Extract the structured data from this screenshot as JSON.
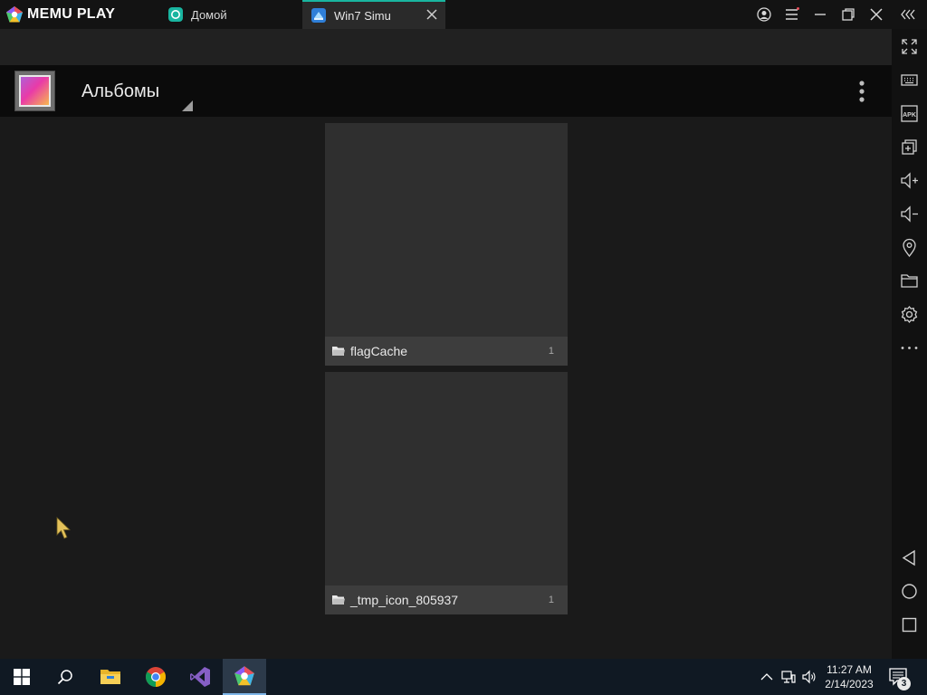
{
  "app": {
    "brand": "MEMU PLAY",
    "tabs": [
      {
        "label": "Домой",
        "icon": "home-tab-icon"
      },
      {
        "label": "Win7 Simu",
        "icon": "win7-tab-icon",
        "active": true
      }
    ],
    "window_controls": [
      "account-icon",
      "menu-icon",
      "minimize-icon",
      "restore-icon",
      "close-icon",
      "collapse-sidebar-icon"
    ]
  },
  "action_bar": {
    "title": "Альбомы",
    "app_icon": "gallery-icon"
  },
  "albums": [
    {
      "name": "flagCache",
      "count": "1"
    },
    {
      "name": "_tmp_icon_805937",
      "count": "1"
    }
  ],
  "sidebar": {
    "buttons": [
      "fullscreen-icon",
      "keyboard-icon",
      "apk-icon",
      "multi-instance-icon",
      "volume-up-icon",
      "volume-down-icon",
      "location-icon",
      "folder-icon",
      "settings-icon",
      "more-icon",
      "back-icon",
      "home-icon",
      "recents-icon"
    ],
    "apk_label": "APK"
  },
  "taskbar": {
    "apps": [
      "windows-start-icon",
      "search-icon",
      "file-explorer-icon",
      "chrome-icon",
      "visual-studio-icon",
      "memu-icon"
    ],
    "clock_time": "11:27 AM",
    "clock_date": "2/14/2023",
    "notification_count": "3"
  },
  "colors": {
    "accent": "#19b5a0",
    "background": "#1a1a1a",
    "album_tile": "#2f2f2f",
    "album_caption": "#3d3d3d"
  }
}
